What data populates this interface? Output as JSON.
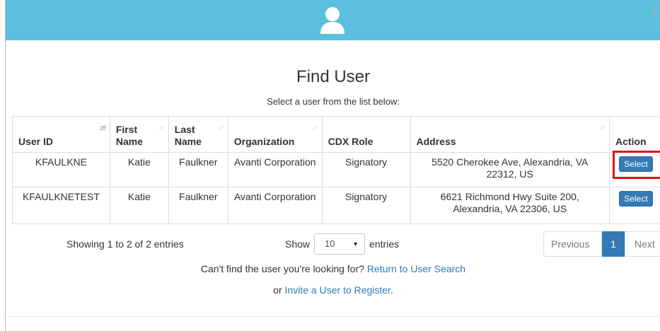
{
  "header": {
    "icon": "user-icon",
    "close_label": "×",
    "color": "#5bc0de"
  },
  "title": "Find User",
  "subtitle": "Select a user from the list below:",
  "table": {
    "columns": [
      {
        "line1": "User ID",
        "line2": ""
      },
      {
        "line1": "First",
        "line2": "Name"
      },
      {
        "line1": "Last",
        "line2": "Name"
      },
      {
        "line1": "Organization",
        "line2": ""
      },
      {
        "line1": "CDX Role",
        "line2": ""
      },
      {
        "line1": "Address",
        "line2": ""
      },
      {
        "line1": "Action",
        "line2": ""
      }
    ],
    "rows": [
      {
        "user_id": "KFAULKNE",
        "first_name": "Katie",
        "last_name": "Faulkner",
        "organization": "Avanti Corporation",
        "role": "Signatory",
        "address": "5520 Cherokee Ave, Alexandria, VA 22312, US",
        "action": "Select"
      },
      {
        "user_id": "KFAULKNETEST",
        "first_name": "Katie",
        "last_name": "Faulkner",
        "organization": "Avanti Corporation",
        "role": "Signatory",
        "address": "6621 Richmond Hwy Suite 200, Alexandria, VA 22306, US",
        "action": "Select"
      }
    ]
  },
  "info": "Showing 1 to 2 of 2 entries",
  "length": {
    "show_label": "Show",
    "value": "10",
    "entries_label": "entries"
  },
  "pagination": {
    "previous": "Previous",
    "current": "1",
    "next": "Next"
  },
  "footer": {
    "line1_text": "Can't find the user you're looking for?",
    "line1_link": "Return to User Search",
    "line2_prefix": "or",
    "line2_link": "Invite a User to Register",
    "line2_suffix": "."
  },
  "colors": {
    "primary": "#337ab7",
    "highlight": "#e0131b"
  }
}
